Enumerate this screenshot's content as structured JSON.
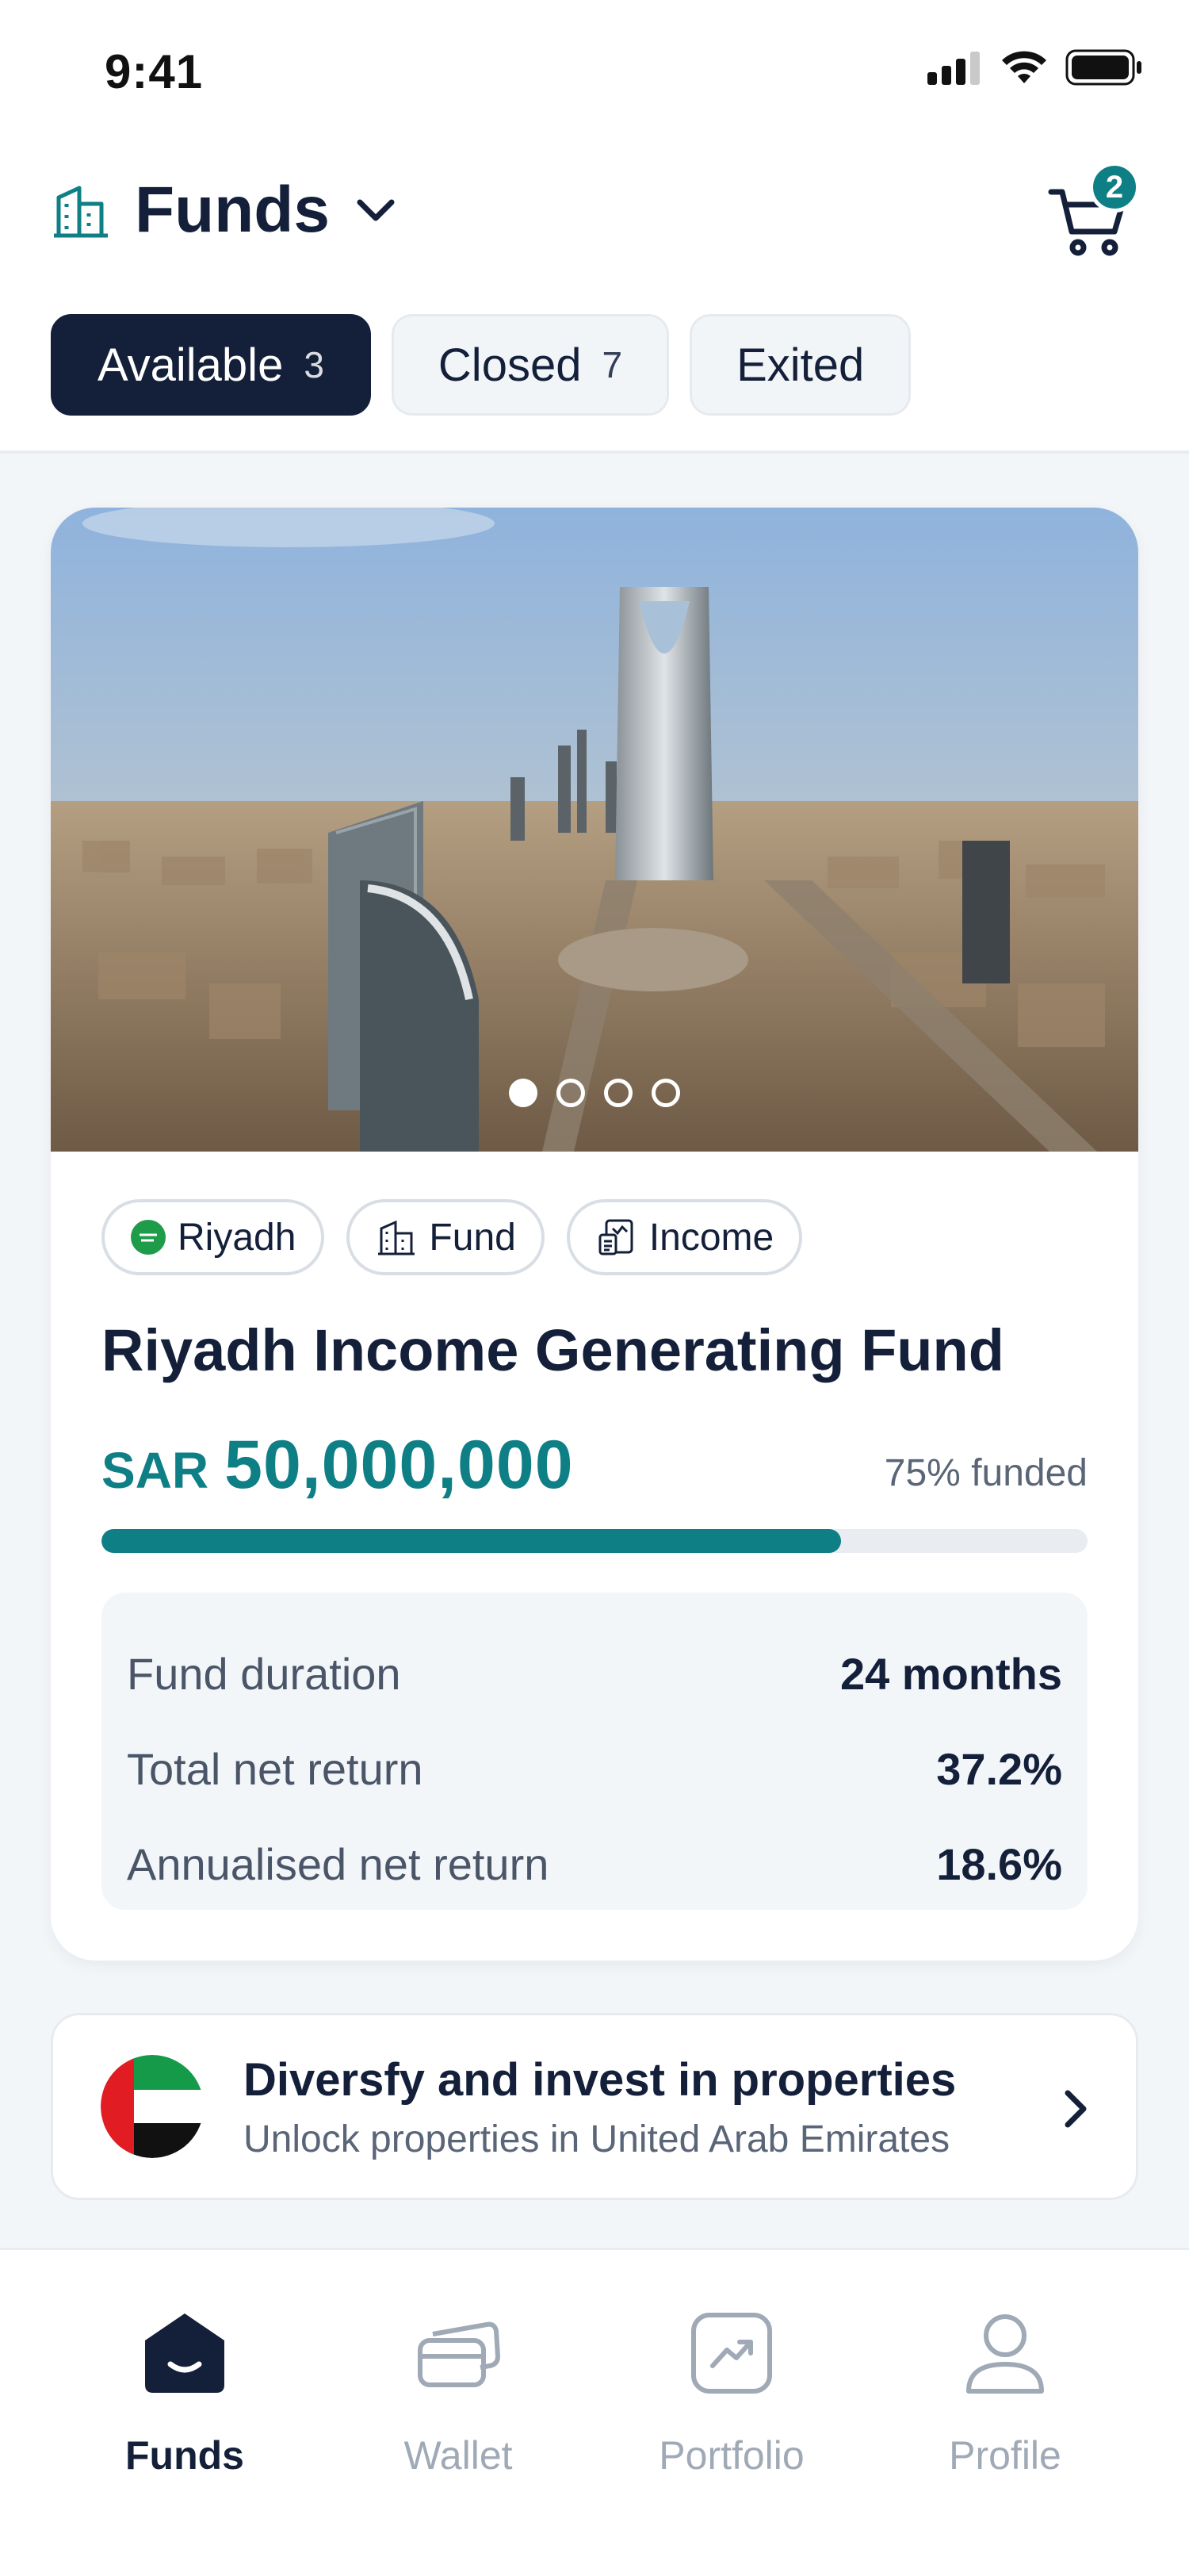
{
  "status_bar": {
    "time": "9:41"
  },
  "header": {
    "title": "Funds",
    "cart_count": "2"
  },
  "tabs": [
    {
      "label": "Available",
      "count": "3"
    },
    {
      "label": "Closed",
      "count": "7"
    },
    {
      "label": "Exited",
      "count": ""
    }
  ],
  "fund_card": {
    "chips": [
      {
        "label": "Riyadh",
        "icon": "saudi-flag-icon"
      },
      {
        "label": "Fund",
        "icon": "building-icon"
      },
      {
        "label": "Income",
        "icon": "income-document-icon"
      }
    ],
    "title": "Riyadh Income Generating Fund",
    "currency": "SAR",
    "amount": "50,000,000",
    "funded_text": "75% funded",
    "funded_fraction": 0.75,
    "image_slide_count": 4,
    "image_active_slide": 1,
    "stats": [
      {
        "label": "Fund duration",
        "value": "24 months"
      },
      {
        "label": "Total net return",
        "value": "37.2%"
      },
      {
        "label": "Annualised net return",
        "value": "18.6%"
      }
    ]
  },
  "promo": {
    "title": "Diversfy and invest in properties",
    "subtitle": "Unlock properties in United Arab Emirates"
  },
  "bottom_nav": [
    {
      "label": "Funds",
      "icon": "home-icon"
    },
    {
      "label": "Wallet",
      "icon": "wallet-icon"
    },
    {
      "label": "Portfolio",
      "icon": "portfolio-icon"
    },
    {
      "label": "Profile",
      "icon": "profile-icon"
    }
  ],
  "colors": {
    "accent": "#0f7f86",
    "primary_dark": "#14203a",
    "muted": "#a0a9b6"
  }
}
